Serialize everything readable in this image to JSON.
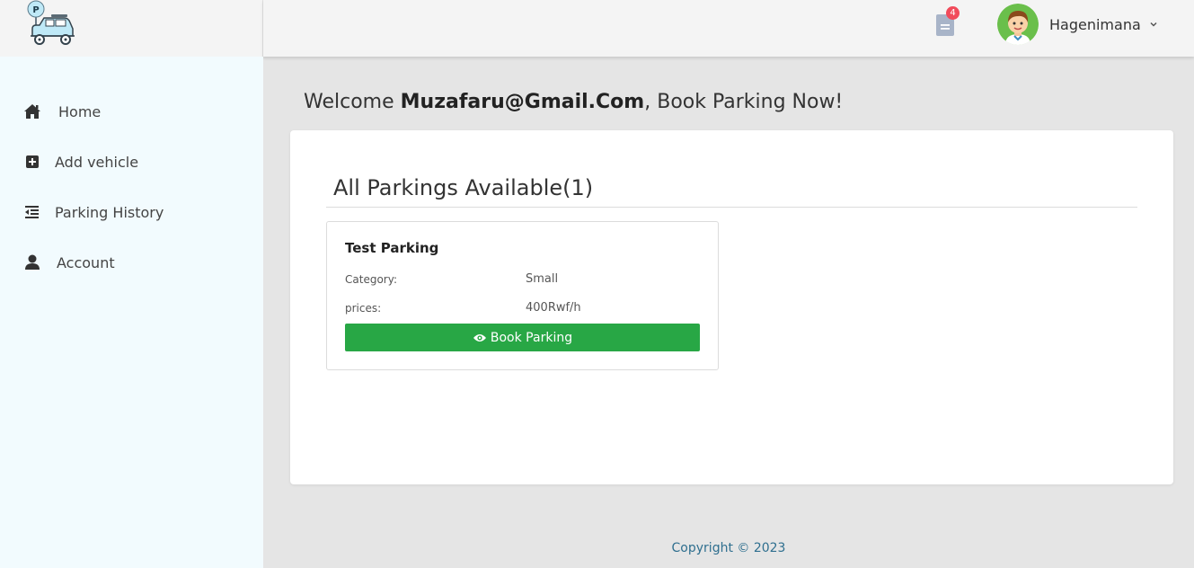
{
  "header": {
    "logo_icon": "parking-car-logo-icon",
    "logo_badge": "P",
    "notifications": {
      "icon": "document-icon",
      "count": "4",
      "badge_color": "#f14b5b"
    },
    "user": {
      "name": "Hagenimana",
      "avatar": "boy-avatar",
      "dropdown_icon": "chevron-down-icon"
    }
  },
  "sidebar": {
    "background": "#f2fbfe",
    "items": [
      {
        "label": "Home",
        "icon": "home-icon"
      },
      {
        "label": "Add vehicle",
        "icon": "plus-square-icon"
      },
      {
        "label": "Parking History",
        "icon": "outdent-icon"
      },
      {
        "label": "Account",
        "icon": "user-icon"
      }
    ]
  },
  "main": {
    "welcome_prefix": "Welcome ",
    "welcome_email": "Muzafaru@Gmail.Com",
    "welcome_suffix": ", Book Parking Now!",
    "section_title": "All Parkings Available(1)",
    "parkings": [
      {
        "name": "Test Parking",
        "category_label": "Category:",
        "category": "Small",
        "prices_label": "prices:",
        "price": "400Rwf/h",
        "button_label": "Book Parking",
        "button_icon": "eye-icon",
        "button_color": "#28a745"
      }
    ]
  },
  "footer": {
    "copyright": "Copyright © 2023"
  }
}
